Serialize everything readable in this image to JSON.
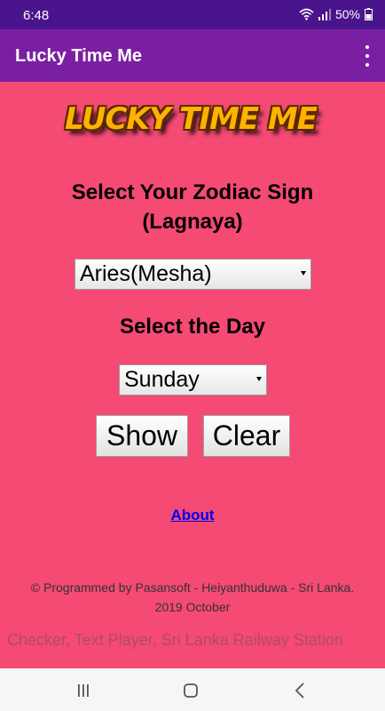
{
  "status_bar": {
    "time": "6:48",
    "battery": "50%"
  },
  "app_bar": {
    "title": "Lucky Time Me"
  },
  "logo": {
    "text": "LUCKY TIME ME"
  },
  "zodiac": {
    "heading_line1": "Select Your Zodiac Sign",
    "heading_line2": "(Lagnaya)",
    "selected": "Aries(Mesha)"
  },
  "day": {
    "heading": "Select the Day",
    "selected": "Sunday"
  },
  "buttons": {
    "show": "Show",
    "clear": "Clear"
  },
  "about": {
    "label": "About"
  },
  "footer": {
    "credit_line1": "© Programmed by Pasansoft - Heiyanthuduwa - Sri Lanka.",
    "credit_line2": "2019 October"
  },
  "marquee": {
    "text": "Checker, Text Player, Sri Lanka Railway Station"
  },
  "colors": {
    "status_bar": "#4a148c",
    "app_bar": "#7b1fa2",
    "background": "#f44a73",
    "link": "#0000ee"
  },
  "icons": [
    "wifi-icon",
    "signal-icon",
    "battery-icon",
    "overflow-menu-icon",
    "recents-icon",
    "home-icon",
    "back-icon"
  ]
}
